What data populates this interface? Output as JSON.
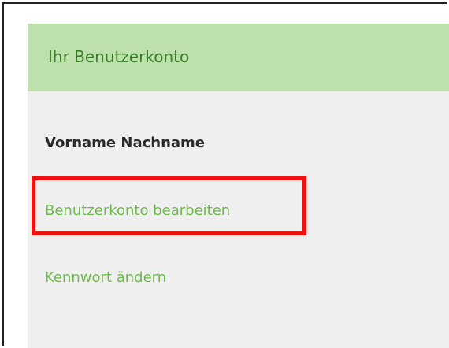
{
  "account_panel": {
    "title": "Ihr Benutzerkonto",
    "user_name": "Vorname Nachname",
    "links": [
      {
        "label": "Benutzerkonto bearbeiten"
      },
      {
        "label": "Kennwort ändern"
      }
    ]
  },
  "colors": {
    "header_background": "#bde0ad",
    "header_text": "#3b7f2a",
    "panel_background": "#efefef",
    "link_text": "#6dbb4a",
    "highlight_border": "#ee1111"
  }
}
